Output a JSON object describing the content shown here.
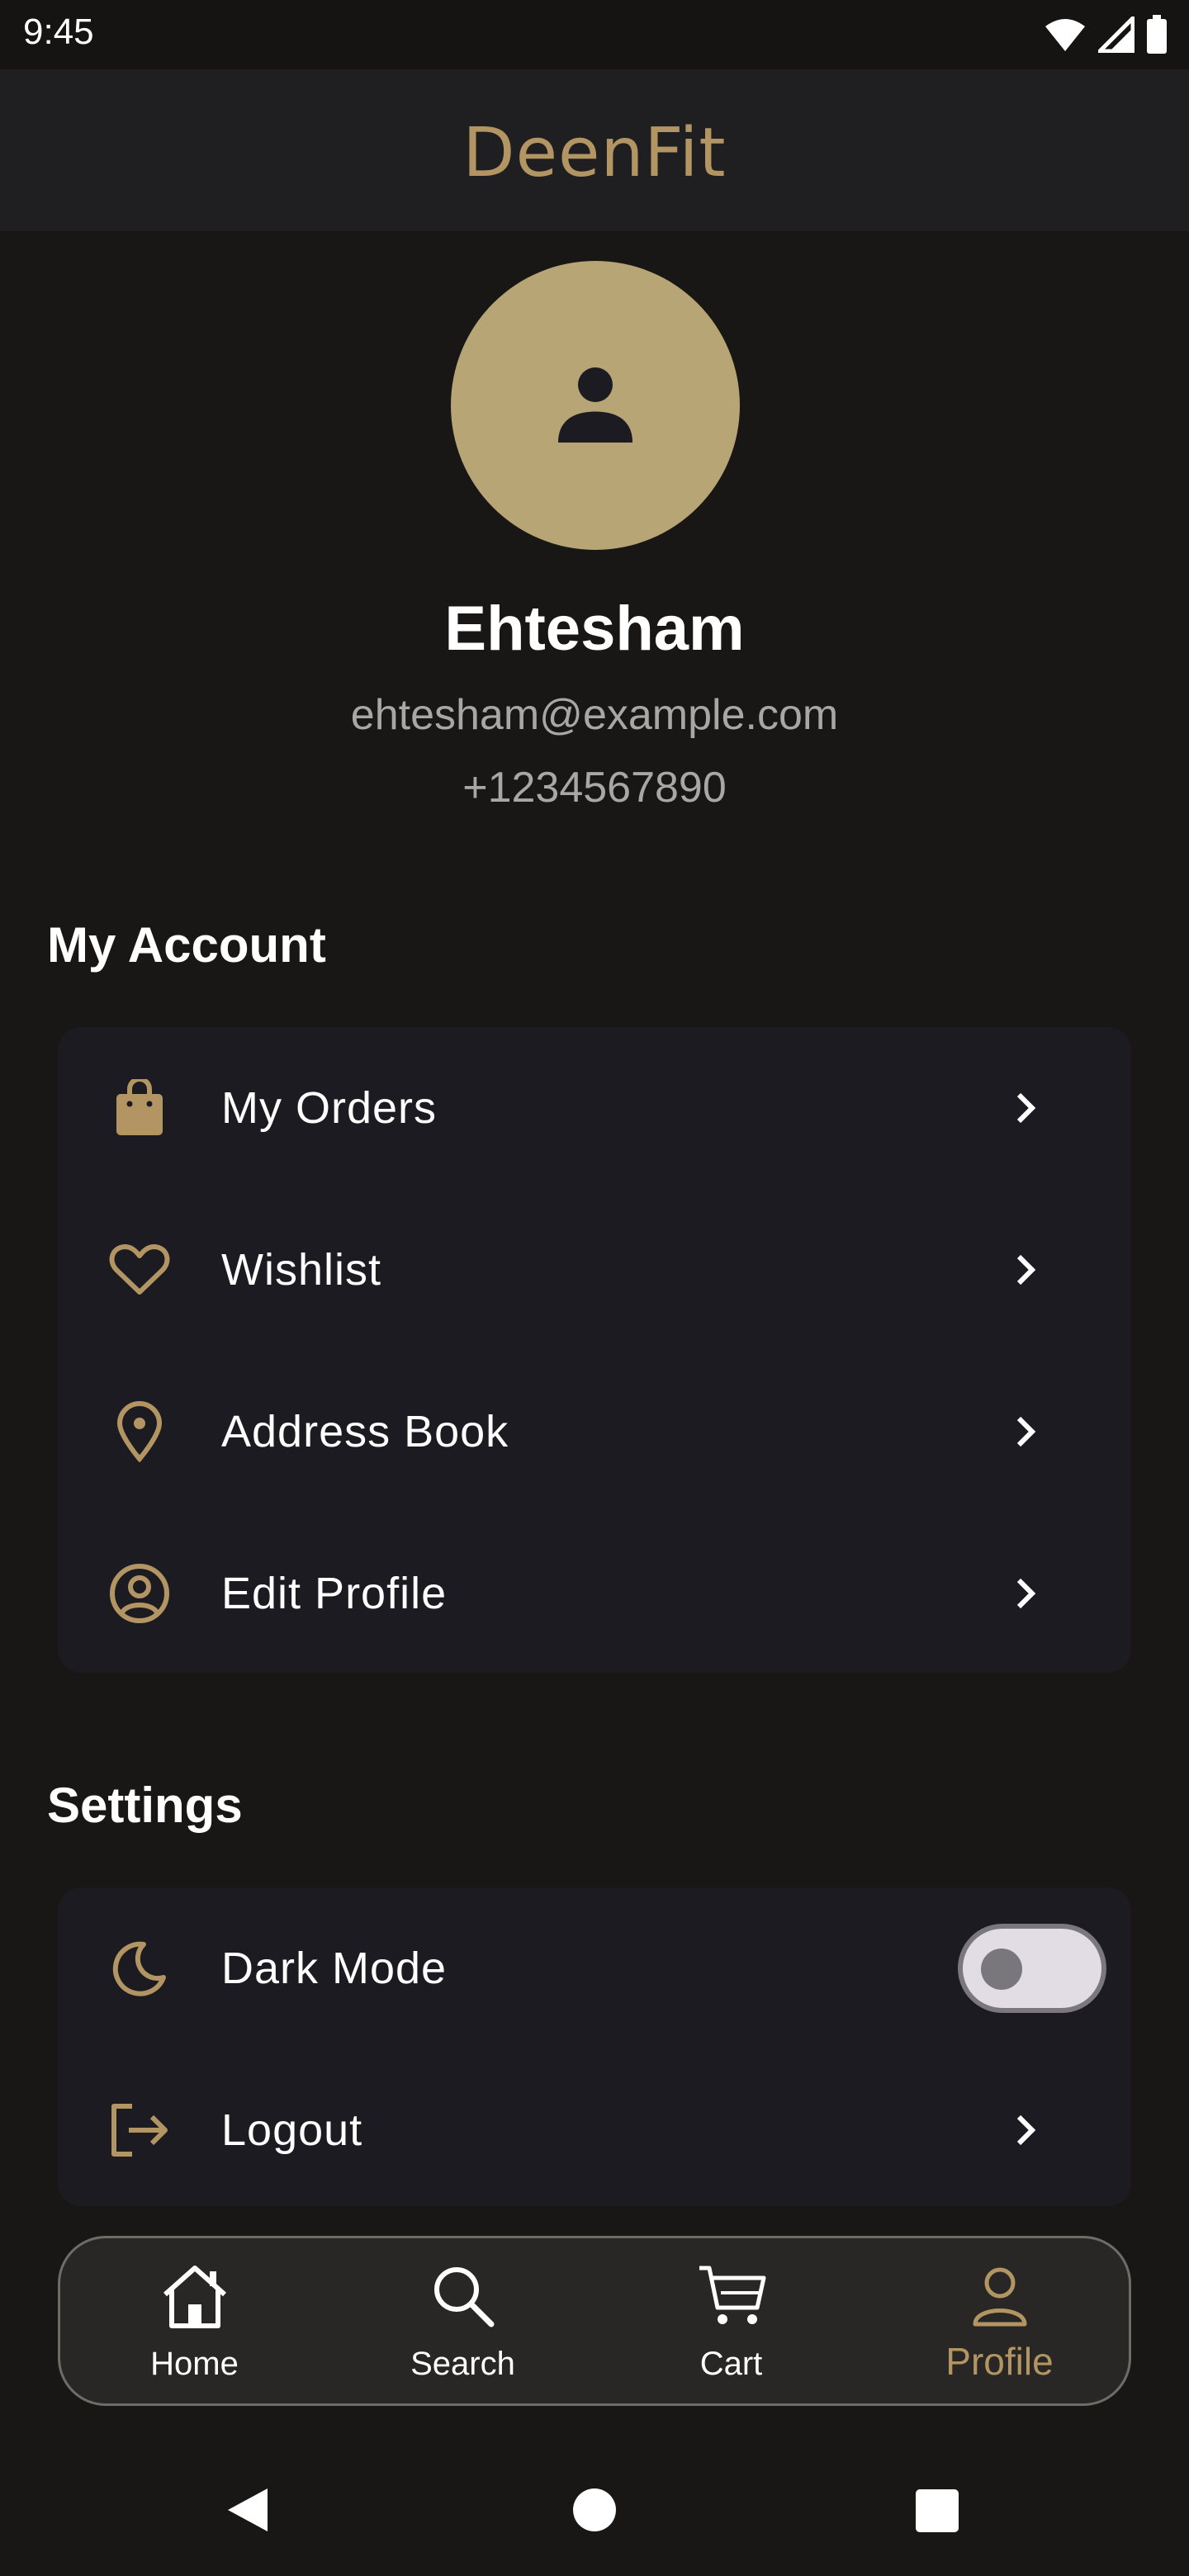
{
  "status_bar": {
    "time": "9:45"
  },
  "app": {
    "logo": "DeenFit"
  },
  "profile": {
    "name": "Ehtesham",
    "email": "ehtesham@example.com",
    "phone": "+1234567890"
  },
  "sections": {
    "my_account": {
      "title": "My Account",
      "items": [
        {
          "label": "My Orders",
          "icon": "shopping-bag-icon"
        },
        {
          "label": "Wishlist",
          "icon": "heart-icon"
        },
        {
          "label": "Address Book",
          "icon": "location-pin-icon"
        },
        {
          "label": "Edit Profile",
          "icon": "account-circle-icon"
        }
      ]
    },
    "settings": {
      "title": "Settings",
      "items": [
        {
          "label": "Dark Mode",
          "icon": "moon-icon",
          "toggle": false
        },
        {
          "label": "Logout",
          "icon": "logout-icon"
        }
      ]
    }
  },
  "bottom_nav": {
    "items": [
      {
        "label": "Home",
        "icon": "home-icon"
      },
      {
        "label": "Search",
        "icon": "search-icon"
      },
      {
        "label": "Cart",
        "icon": "cart-icon"
      },
      {
        "label": "Profile",
        "icon": "profile-icon",
        "active": true
      }
    ]
  },
  "colors": {
    "background": "#191715",
    "accent": "#b39563",
    "card": "#1c1b21",
    "avatar": "#b8a575"
  }
}
